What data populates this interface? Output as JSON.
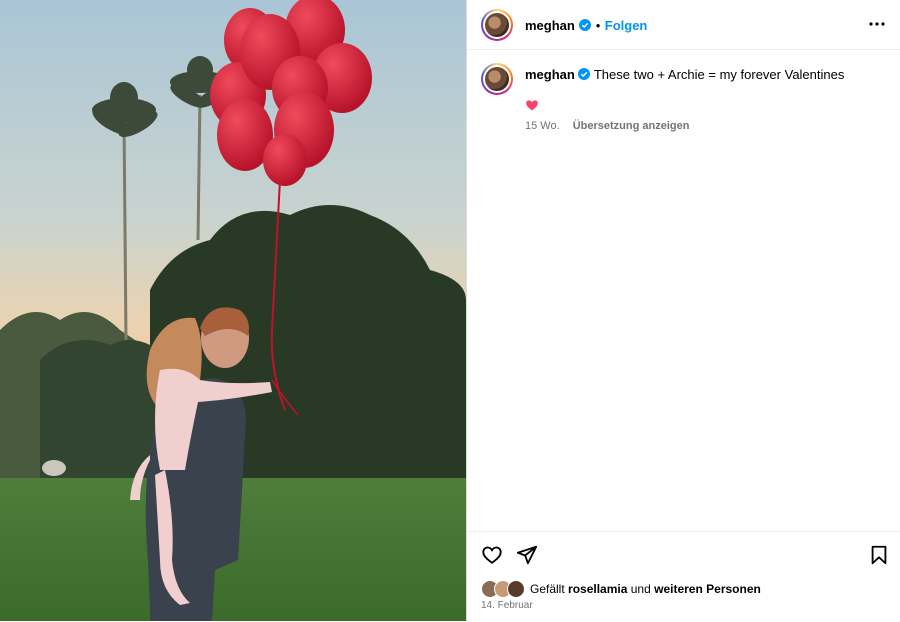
{
  "post": {
    "username": "meghan",
    "separator": "•",
    "follow_label": "Folgen",
    "caption_user": "meghan",
    "caption_text": "These two + Archie = my forever Valentines",
    "emoji": "heart",
    "age": "15 Wo.",
    "translate_label": "Übersetzung anzeigen"
  },
  "likes": {
    "prefix": "Gefällt",
    "user": "rosellamia",
    "middle": "und",
    "rest": "weiteren Personen"
  },
  "date": "14. Februar",
  "icons": {
    "more": "more-options-icon",
    "like": "heart-outline-icon",
    "share": "paper-plane-icon",
    "save": "bookmark-icon",
    "verified": "verified-badge-icon"
  },
  "colors": {
    "link": "#0095f6",
    "verified": "#0095f6",
    "secondary_text": "#737373",
    "balloon": "#d9213a"
  }
}
